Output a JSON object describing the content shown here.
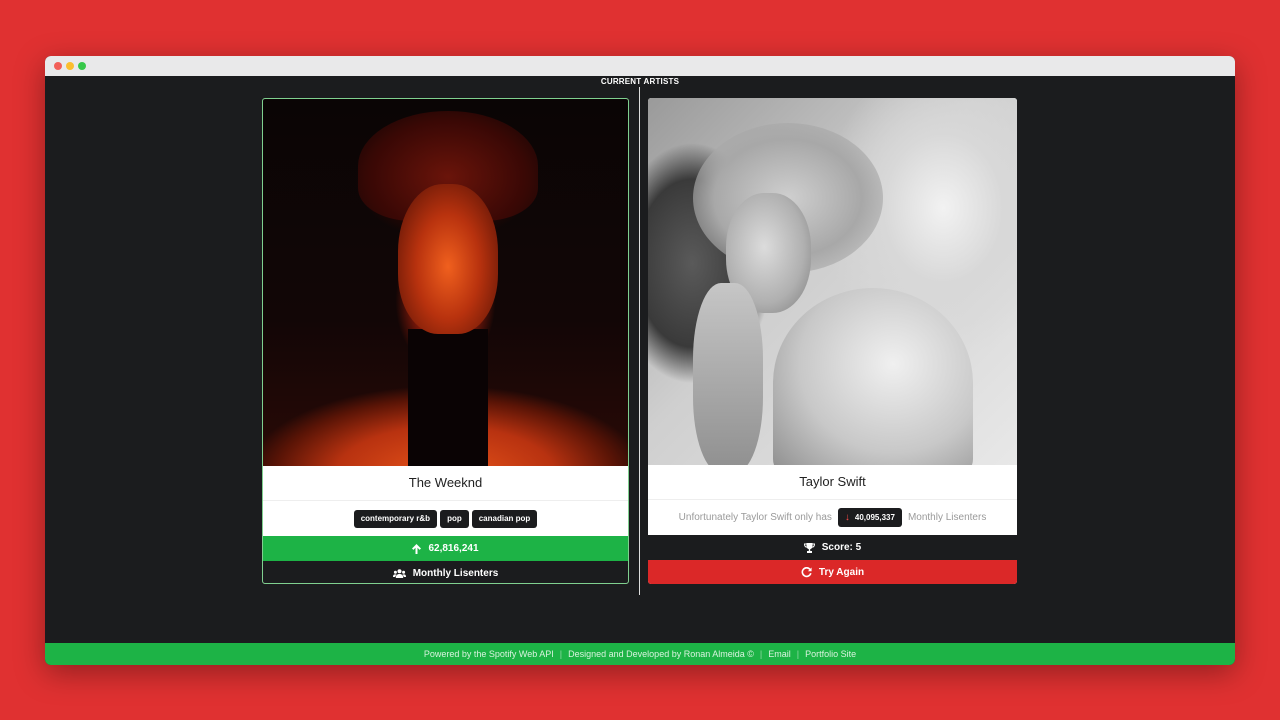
{
  "section_title": "CURRENT ARTISTS",
  "left_artist": {
    "name": "The Weeknd",
    "genres": [
      "contemporary r&b",
      "pop",
      "canadian pop"
    ],
    "listeners": "62,816,241",
    "listeners_label": "Monthly Lisenters",
    "icons": {
      "listeners_arrow": "arrow-up-icon",
      "people": "users-icon"
    }
  },
  "right_artist": {
    "name": "Taylor Swift",
    "result_prefix": "Unfortunately Taylor Swift only has",
    "listeners": "40,095,337",
    "result_suffix": "Monthly Lisenters",
    "score_label": "Score: 5",
    "try_again_label": "Try Again",
    "icons": {
      "listeners_arrow": "arrow-down-icon",
      "score": "trophy-icon",
      "retry": "redo-icon"
    }
  },
  "footer": {
    "powered_by": "Powered by the Spotify Web API",
    "credit": "Designed and Developed by Ronan Almeida ©",
    "email": "Email",
    "portfolio": "Portfolio Site"
  },
  "colors": {
    "page_bg": "#e03131",
    "app_bg": "#1b1c1e",
    "accent_green": "#1db346",
    "danger_red": "#db2828"
  }
}
